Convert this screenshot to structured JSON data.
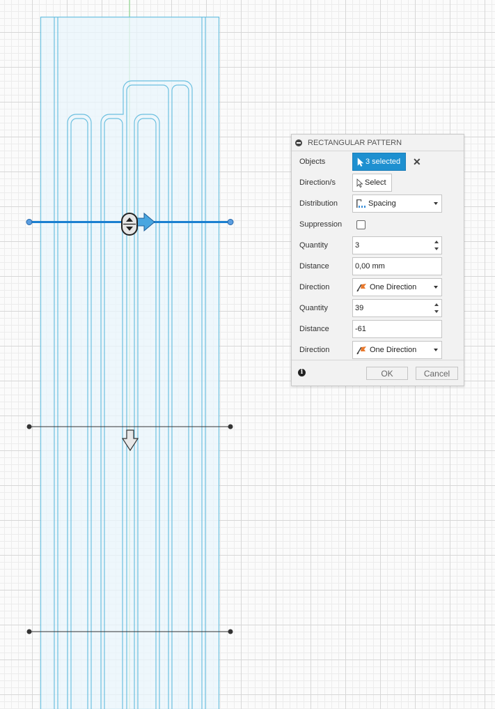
{
  "panel": {
    "title": "RECTANGULAR PATTERN",
    "objects": {
      "label": "Objects",
      "value": "3 selected",
      "icon": "cursor-icon"
    },
    "directions": {
      "label": "Direction/s",
      "button": "Select",
      "icon": "cursor-icon"
    },
    "distribution": {
      "label": "Distribution",
      "value": "Spacing",
      "icon": "spacing-icon"
    },
    "suppression": {
      "label": "Suppression",
      "checked": false
    },
    "quantity1": {
      "label": "Quantity",
      "value": "3"
    },
    "distance1": {
      "label": "Distance",
      "value": "0,00 mm"
    },
    "direction1": {
      "label": "Direction",
      "value": "One Direction",
      "icon": "flag-icon"
    },
    "quantity2": {
      "label": "Quantity",
      "value": "39"
    },
    "distance2": {
      "label": "Distance",
      "value": "-61"
    },
    "direction2": {
      "label": "Direction",
      "value": "One Direction",
      "icon": "flag-icon"
    },
    "footer": {
      "ok": "OK",
      "cancel": "Cancel",
      "info_icon": "info-icon"
    }
  },
  "colors": {
    "sketch_line": "#6cc0e0",
    "sketch_fill": "#eaf6fc",
    "manipulator": "#1a7fd0",
    "selected_button": "#1e90d0",
    "axis": "#7bd07b"
  }
}
